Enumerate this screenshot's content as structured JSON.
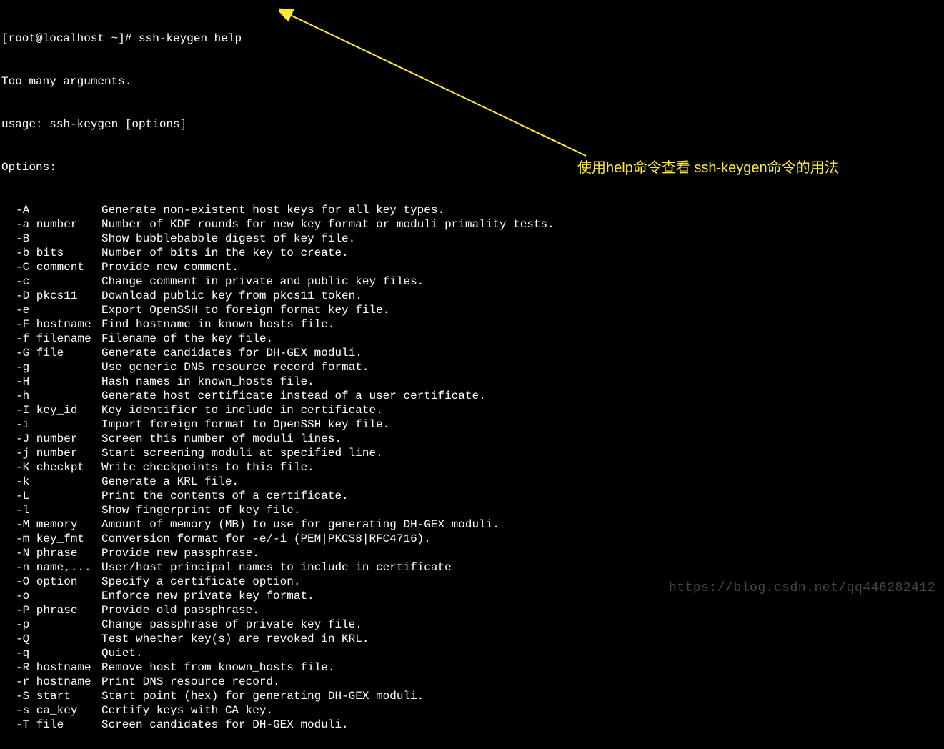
{
  "terminal": {
    "prompt": "[root@localhost ~]# ssh-keygen help",
    "error": "Too many arguments.",
    "usage": "usage: ssh-keygen [options]",
    "options_header": "Options:",
    "options": [
      {
        "flag": "-A",
        "desc": "Generate non-existent host keys for all key types."
      },
      {
        "flag": "-a number",
        "desc": "Number of KDF rounds for new key format or moduli primality tests."
      },
      {
        "flag": "-B",
        "desc": "Show bubblebabble digest of key file."
      },
      {
        "flag": "-b bits",
        "desc": "Number of bits in the key to create."
      },
      {
        "flag": "-C comment",
        "desc": "Provide new comment."
      },
      {
        "flag": "-c",
        "desc": "Change comment in private and public key files."
      },
      {
        "flag": "-D pkcs11",
        "desc": "Download public key from pkcs11 token."
      },
      {
        "flag": "-e",
        "desc": "Export OpenSSH to foreign format key file."
      },
      {
        "flag": "-F hostname",
        "desc": "Find hostname in known hosts file."
      },
      {
        "flag": "-f filename",
        "desc": "Filename of the key file."
      },
      {
        "flag": "-G file",
        "desc": "Generate candidates for DH-GEX moduli."
      },
      {
        "flag": "-g",
        "desc": "Use generic DNS resource record format."
      },
      {
        "flag": "-H",
        "desc": "Hash names in known_hosts file."
      },
      {
        "flag": "-h",
        "desc": "Generate host certificate instead of a user certificate."
      },
      {
        "flag": "-I key_id",
        "desc": "Key identifier to include in certificate."
      },
      {
        "flag": "-i",
        "desc": "Import foreign format to OpenSSH key file."
      },
      {
        "flag": "-J number",
        "desc": "Screen this number of moduli lines."
      },
      {
        "flag": "-j number",
        "desc": "Start screening moduli at specified line."
      },
      {
        "flag": "-K checkpt",
        "desc": "Write checkpoints to this file."
      },
      {
        "flag": "-k",
        "desc": "Generate a KRL file."
      },
      {
        "flag": "-L",
        "desc": "Print the contents of a certificate."
      },
      {
        "flag": "-l",
        "desc": "Show fingerprint of key file."
      },
      {
        "flag": "-M memory",
        "desc": "Amount of memory (MB) to use for generating DH-GEX moduli."
      },
      {
        "flag": "-m key_fmt",
        "desc": "Conversion format for -e/-i (PEM|PKCS8|RFC4716)."
      },
      {
        "flag": "-N phrase",
        "desc": "Provide new passphrase."
      },
      {
        "flag": "-n name,...",
        "desc": "User/host principal names to include in certificate"
      },
      {
        "flag": "-O option",
        "desc": "Specify a certificate option."
      },
      {
        "flag": "-o",
        "desc": "Enforce new private key format."
      },
      {
        "flag": "-P phrase",
        "desc": "Provide old passphrase."
      },
      {
        "flag": "-p",
        "desc": "Change passphrase of private key file."
      },
      {
        "flag": "-Q",
        "desc": "Test whether key(s) are revoked in KRL."
      },
      {
        "flag": "-q",
        "desc": "Quiet."
      },
      {
        "flag": "-R hostname",
        "desc": "Remove host from known_hosts file."
      },
      {
        "flag": "-r hostname",
        "desc": "Print DNS resource record."
      },
      {
        "flag": "-S start",
        "desc": "Start point (hex) for generating DH-GEX moduli."
      },
      {
        "flag": "-s ca_key",
        "desc": "Certify keys with CA key."
      },
      {
        "flag": "-T file",
        "desc": "Screen candidates for DH-GEX moduli."
      }
    ]
  },
  "annotation": {
    "text": "使用help命令查看 ssh-keygen命令的用法"
  },
  "watermark": {
    "text": "https://blog.csdn.net/qq446282412"
  }
}
